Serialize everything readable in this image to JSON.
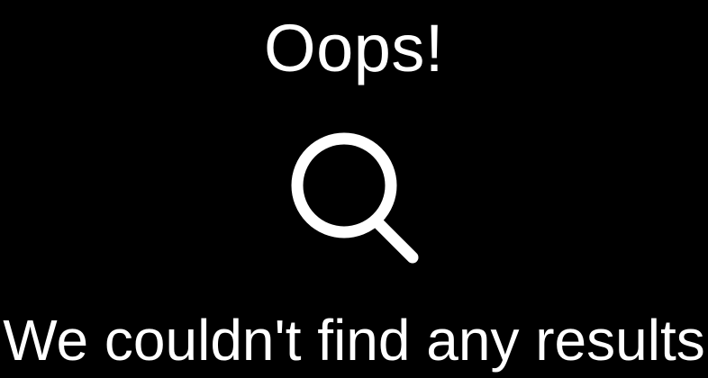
{
  "empty_state": {
    "title": "Oops!",
    "icon": "search-icon",
    "message": "We couldn't find any results"
  },
  "colors": {
    "background": "#000000",
    "foreground": "#ffffff"
  }
}
